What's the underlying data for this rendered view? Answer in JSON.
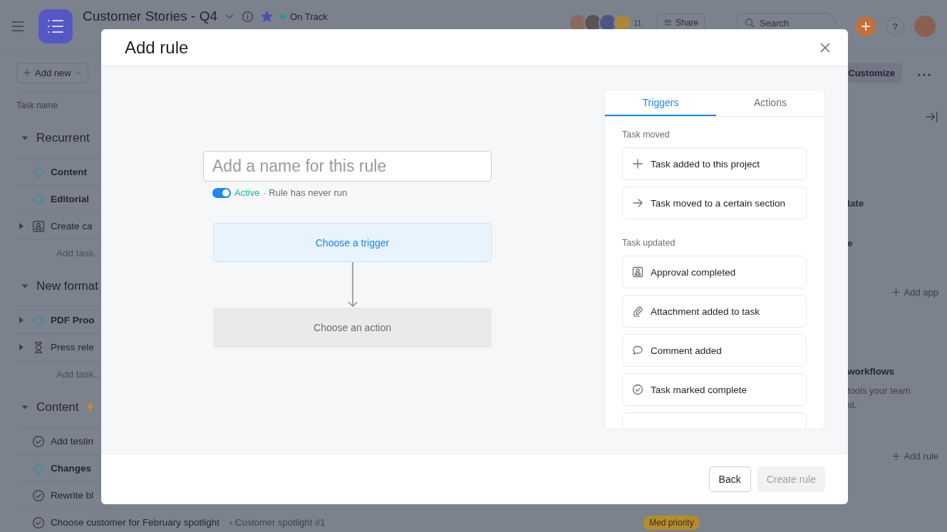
{
  "project": {
    "title": "Customer Stories - Q4",
    "favorite": true,
    "status": {
      "label": "On Track",
      "color": "#1e9e7e"
    },
    "member_count": "11",
    "share": "Share",
    "search": {
      "placeholder": "Search"
    },
    "help": "?"
  },
  "toolbar": {
    "add_new": "Add new",
    "customize": "Customize"
  },
  "task_list": {
    "column_header": "Task name",
    "sections": [
      {
        "name": "Recurrent",
        "expanded": true,
        "kind": "plain",
        "tasks": [
          {
            "name": "Content",
            "kind": "milestone",
            "has_subtasks": false
          },
          {
            "name": "Editorial",
            "kind": "milestone",
            "has_subtasks": false
          },
          {
            "name": "Create ca",
            "kind": "approval",
            "has_subtasks": true
          }
        ],
        "add_task": "Add task.."
      },
      {
        "name": "New format",
        "expanded": true,
        "kind": "plain",
        "tasks": [
          {
            "name": "PDF Proo",
            "kind": "milestone",
            "has_subtasks": true
          },
          {
            "name": "Press rele",
            "kind": "waiting",
            "has_subtasks": true
          }
        ],
        "add_task": "Add task.."
      },
      {
        "name": "Content",
        "expanded": true,
        "kind": "automated",
        "tasks": [
          {
            "name": "Add testin",
            "kind": "task",
            "has_subtasks": false
          },
          {
            "name": "Changes",
            "kind": "milestone",
            "has_subtasks": false
          },
          {
            "name": "Rewrite bl",
            "kind": "task",
            "has_subtasks": false
          },
          {
            "name": "Choose customer for February spotlight",
            "kind": "task",
            "has_subtasks": false,
            "parent": "‹ Customer spotlight #1",
            "tag": {
              "label": "Med priority",
              "color": "#b48c2c"
            }
          }
        ]
      }
    ]
  },
  "side_panel": {
    "lines": [
      "late",
      "e"
    ],
    "add_app": "Add app",
    "workflow_title": "workflows",
    "workflow_text": [
      "tools your team",
      "st."
    ],
    "add_rule": "Add rule"
  },
  "modal": {
    "title": "Add rule",
    "name_field": {
      "placeholder": "Add a name for this rule"
    },
    "rule": {
      "active": true,
      "status": "Active",
      "note": "· Rule has never run"
    },
    "trigger": "Choose a trigger",
    "action": "Choose an action",
    "tabs": [
      {
        "label": "Triggers",
        "selected": true
      },
      {
        "label": "Actions",
        "selected": false
      }
    ],
    "groups": [
      {
        "heading": "Task moved",
        "items": [
          {
            "label": "Task added to this project",
            "kind": "plus"
          },
          {
            "label": "Task moved to a certain section",
            "kind": "arrow"
          }
        ]
      },
      {
        "heading": "Task updated",
        "more_below": true,
        "items": [
          {
            "label": "Approval completed",
            "kind": "approval"
          },
          {
            "label": "Attachment added to task",
            "kind": "paperclip"
          },
          {
            "label": "Comment added",
            "kind": "comment"
          },
          {
            "label": "Task marked complete",
            "kind": "check"
          }
        ]
      }
    ],
    "buttons": {
      "back": "Back",
      "create": {
        "label": "Create rule",
        "disabled": true
      }
    }
  }
}
